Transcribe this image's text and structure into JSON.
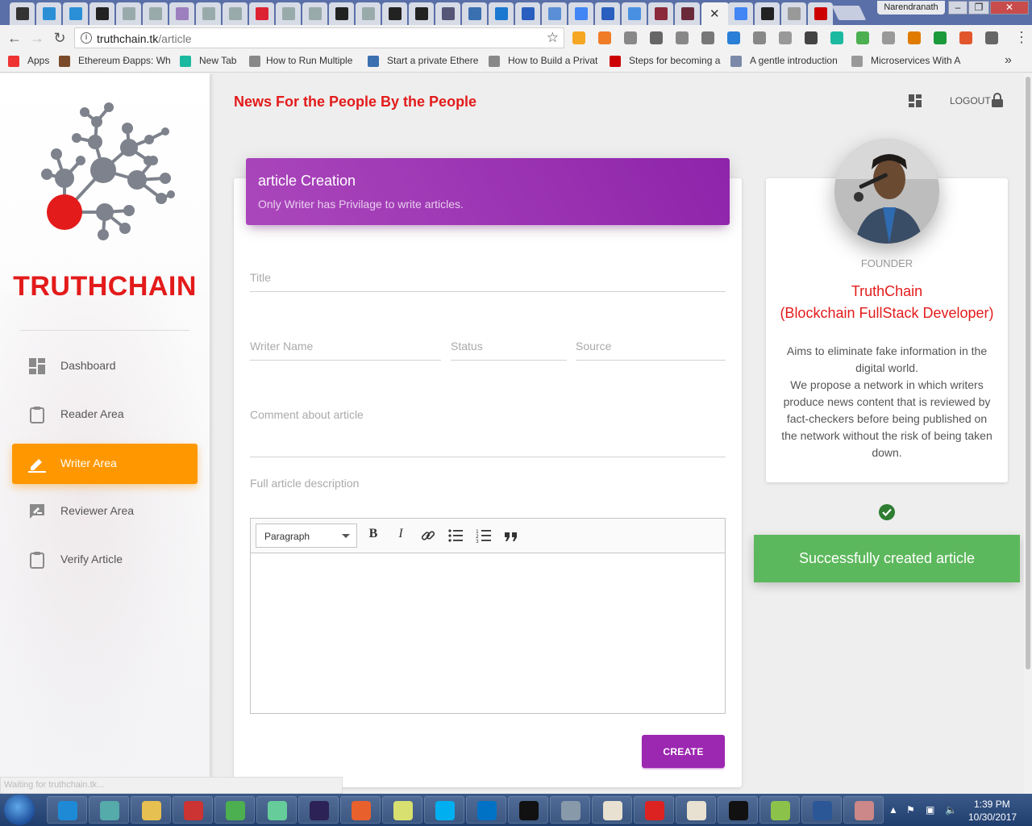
{
  "browser": {
    "user_name": "Narendranath",
    "url_host": "truthchain.tk",
    "url_path": "/article",
    "tab_close": "✕",
    "bookmarks": [
      {
        "label": "Apps"
      },
      {
        "label": "Ethereum Ðapps: Wh"
      },
      {
        "label": "New Tab"
      },
      {
        "label": "How to Run Multiple"
      },
      {
        "label": "Start a private Ethere"
      },
      {
        "label": "How to Build a Privat"
      },
      {
        "label": "Steps for becoming a"
      },
      {
        "label": "A gentle introduction"
      },
      {
        "label": "Microservices With A"
      }
    ],
    "status_text": "Waiting for truthchain.tk..."
  },
  "sidebar": {
    "brand": "TRUTHCHAIN",
    "items": [
      {
        "label": "Dashboard",
        "icon": "dashboard-icon"
      },
      {
        "label": "Reader Area",
        "icon": "clipboard-icon"
      },
      {
        "label": "Writer Area",
        "icon": "pencil-icon",
        "active": true
      },
      {
        "label": "Reviewer Area",
        "icon": "rate-review-icon"
      },
      {
        "label": "Verify Article",
        "icon": "clipboard-icon"
      }
    ]
  },
  "header": {
    "tagline": "News For the People By the People",
    "logout": "LOGOUT"
  },
  "article_form": {
    "title": "article Creation",
    "subtitle": "Only Writer has Privilage to write articles.",
    "fields": {
      "title": "Title",
      "writer_name": "Writer Name",
      "status": "Status",
      "source": "Source",
      "comment": "Comment about article",
      "description": "Full article description"
    },
    "editor": {
      "paragraph": "Paragraph",
      "bold": "B",
      "italic": "I"
    },
    "create_button": "CREATE"
  },
  "profile": {
    "role": "FOUNDER",
    "name_line1": "TruthChain",
    "name_line2": "(Blockchain FullStack Developer)",
    "desc_line1": "Aims to eliminate fake information in the digital world.",
    "desc_line2": "We propose a network in which writers produce news content that is reviewed by fact-checkers before being published on the network without the risk of being taken down."
  },
  "notification": {
    "message": "Successfully created article",
    "color": "#5cb85c"
  },
  "taskbar": {
    "time": "1:39 PM",
    "date": "10/30/2017"
  },
  "colors": {
    "brand_red": "#e31b1b",
    "purple": "#9c27b0",
    "orange": "#ff9800"
  }
}
